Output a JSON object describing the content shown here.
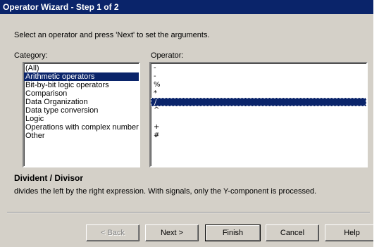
{
  "window": {
    "title": "Operator Wizard - Step 1 of 2"
  },
  "instruction": "Select an operator and press 'Next' to set the arguments.",
  "category": {
    "label": "Category:",
    "items": [
      "(All)",
      "Arithmetic operators",
      "Bit-by-bit logic operators",
      "Comparison",
      "Data Organization",
      "Data type conversion",
      "Logic",
      "Operations with complex numbers",
      "Other"
    ],
    "selected": "Arithmetic operators"
  },
  "operator": {
    "label": "Operator:",
    "items": [
      "-",
      "-",
      "%",
      "*",
      "/",
      "^",
      "",
      "+",
      "#"
    ],
    "selected": "/"
  },
  "description": {
    "title": "Divident / Divisor",
    "text": "divides the left by the right expression. With signals, only the Y-component is processed."
  },
  "buttons": {
    "back": "< Back",
    "next": "Next >",
    "finish": "Finish",
    "cancel": "Cancel",
    "help": "Help"
  },
  "colors": {
    "selection": "#0a246a",
    "dialog_bg": "#d4d0c8"
  }
}
